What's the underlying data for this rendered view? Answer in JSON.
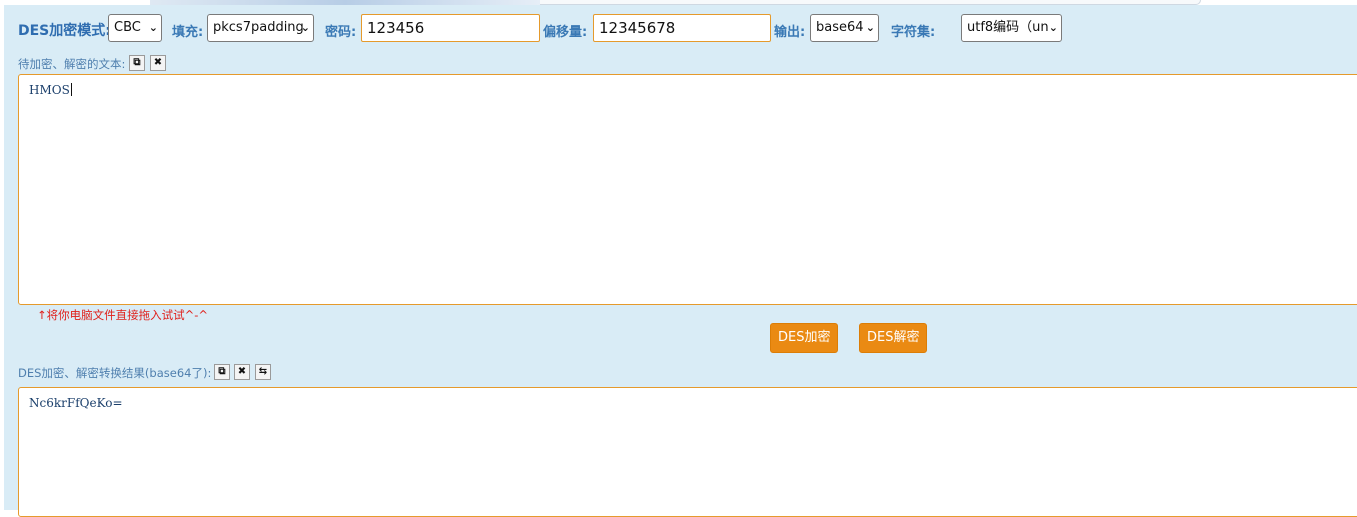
{
  "toolbar": {
    "mode_label": "DES加密模式:",
    "mode_value": "CBC",
    "padding_label": "填充:",
    "padding_value": "pkcs7padding",
    "password_label": "密码:",
    "password_value": "123456",
    "iv_label": "偏移量:",
    "iv_value": "12345678",
    "output_label": "输出:",
    "output_value": "base64",
    "charset_label": "字符集:",
    "charset_value": "utf8编码（un"
  },
  "input_section": {
    "label": "待加密、解密的文本:",
    "text": "HMOS",
    "hint": "↑将你电脑文件直接拖入试试^-^"
  },
  "actions": {
    "encrypt_label": "DES加密",
    "decrypt_label": "DES解密"
  },
  "output_section": {
    "label": "DES加密、解密转换结果(base64了):",
    "text": "Nc6krFfQeKo="
  },
  "icons": {
    "copy": "copy-icon",
    "clear": "clear-icon",
    "swap": "swap-icon"
  },
  "colors": {
    "panel_bg": "#d9ecf6",
    "accent_orange": "#ea8a13",
    "label_blue": "#3a79b5",
    "hint_red": "#e0201b"
  }
}
